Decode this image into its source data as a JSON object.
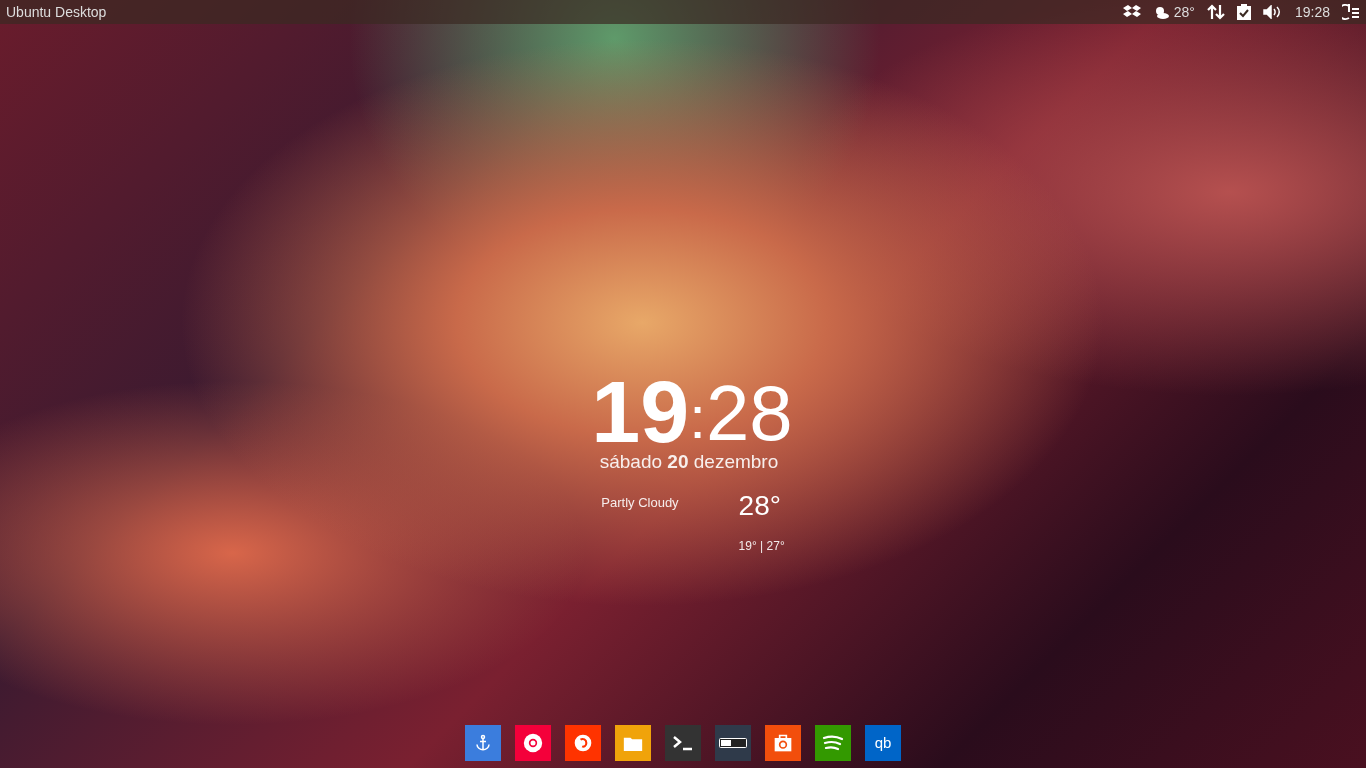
{
  "top_panel": {
    "title": "Ubuntu Desktop",
    "weather_temp": "28°",
    "time": "19:28"
  },
  "clock": {
    "hours": "19",
    "separator": ":",
    "minutes": "28",
    "date": "sábado **20** dezembro"
  },
  "weather": {
    "condition": "Partly Cloudy",
    "temperature": "28°",
    "range": "19° | 27°"
  },
  "dock": [
    {
      "kind": "anchor",
      "color": "#3b7ddd"
    },
    {
      "kind": "chrome",
      "color": "#f4003a"
    },
    {
      "kind": "firefox",
      "color": "#ff3300"
    },
    {
      "kind": "folder",
      "color": "#f0a30a"
    },
    {
      "kind": "terminal",
      "color": "#333333"
    },
    {
      "kind": "toggle",
      "color": "#2f3a4a"
    },
    {
      "kind": "store",
      "color": "#f24e0c"
    },
    {
      "kind": "spotify",
      "color": "#339900"
    },
    {
      "kind": "text",
      "color": "#0065c8",
      "label": "qb"
    }
  ]
}
